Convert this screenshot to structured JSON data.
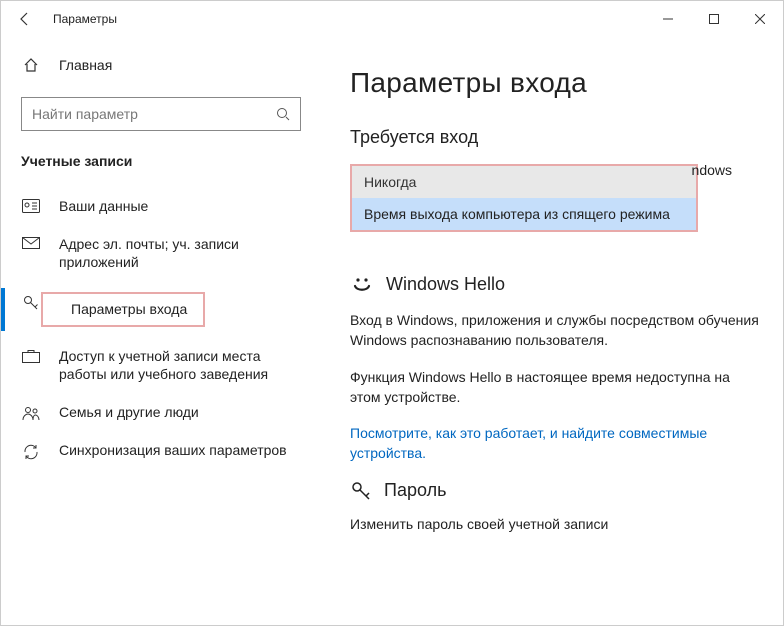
{
  "titlebar": {
    "title": "Параметры"
  },
  "sidebar": {
    "home": "Главная",
    "search_placeholder": "Найти параметр",
    "category": "Учетные записи",
    "items": [
      {
        "label": "Ваши данные"
      },
      {
        "label": "Адрес эл. почты; уч. записи приложений"
      },
      {
        "label": "Параметры входа"
      },
      {
        "label": "Доступ к учетной записи места работы или учебного заведения"
      },
      {
        "label": "Семья и другие люди"
      },
      {
        "label": "Синхронизация ваших параметров"
      }
    ]
  },
  "main": {
    "heading": "Параметры входа",
    "section_signin": "Требуется вход",
    "bg_text": "ndows",
    "dropdown": {
      "opt1": "Никогда",
      "opt2": "Время выхода компьютера из спящего режима"
    },
    "hello_title": "Windows Hello",
    "hello_desc": "Вход в Windows, приложения и службы посредством обучения Windows распознаванию пользователя.",
    "hello_unavail": "Функция Windows Hello в настоящее время недоступна на этом устройстве.",
    "hello_link": "Посмотрите, как это работает, и найдите совместимые устройства.",
    "pwd_title": "Пароль",
    "pwd_desc": "Изменить пароль своей учетной записи"
  }
}
